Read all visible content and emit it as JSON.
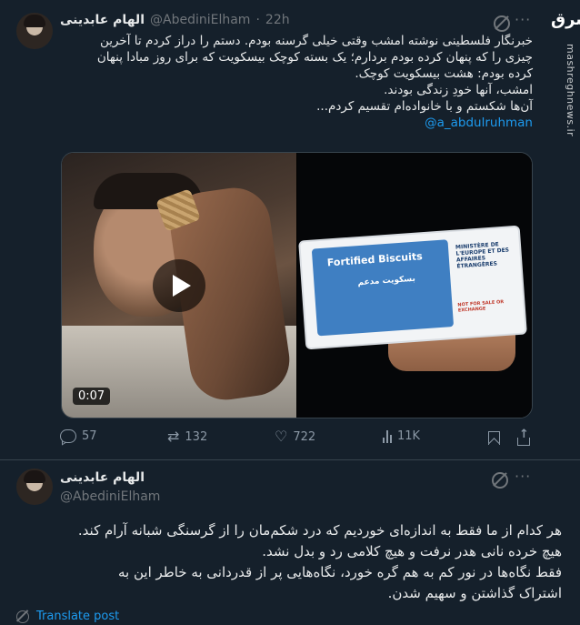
{
  "tweet1": {
    "display_name": "الهام عابدینی",
    "handle": "@AbediniElham",
    "separator": "·",
    "time": "22h",
    "more": "···",
    "lines": [
      "خبرنگار فلسطینی نوشته امشب وقتی خیلی گرسنه بودم. دستم را دراز کردم تا آخرین",
      "چیزی را که پنهان کرده بودم بردارم؛ یک بسته کوچک بیسکویت که برای روز مبادا پنهان",
      "کرده بودم: هشت بیسکویت کوچک.",
      "امشب، آنها خودِ زندگی بودند.",
      "آن‌ها شکستم و با خانواده‌ام تقسیم کردم..."
    ],
    "mention": "@a_abdulruhman",
    "video_duration": "0:07",
    "package": {
      "brand": "Fortified Biscuits",
      "arabic": "بسکویت مدعم",
      "ministry": "MINISTÈRE DE L'EUROPE ET DES AFFAIRES ÉTRANGÈRES",
      "notice": "NOT FOR SALE OR EXCHANGE"
    },
    "stats": {
      "replies": "57",
      "reposts": "132",
      "likes": "722",
      "views": "11K"
    }
  },
  "tweet2": {
    "display_name": "الهام عابدینی",
    "handle": "@AbediniElham",
    "more": "···",
    "lines": [
      "هر کدام از ما فقط به اندازه‌ای خوردیم که درد شکم‌مان را از گرسنگی شبانه آرام کند.",
      "هیچ خرده نانی هدر نرفت و هیچ کلامی رد و بدل نشد.",
      "فقط نگاه‌ها در نور کم به هم گره خورد، نگاه‌هایی پر از قدردانی به خاطر این به",
      "اشتراک گذاشتن و سهیم شدن."
    ],
    "translate_label": "Translate post"
  },
  "watermark": {
    "logo": "مشرق",
    "site": "mashreghnews.ir"
  },
  "colors": {
    "background": "#15202b",
    "text": "#e7e9ea",
    "muted": "#71767b",
    "link": "#1d9bf0",
    "border": "#38444d"
  }
}
